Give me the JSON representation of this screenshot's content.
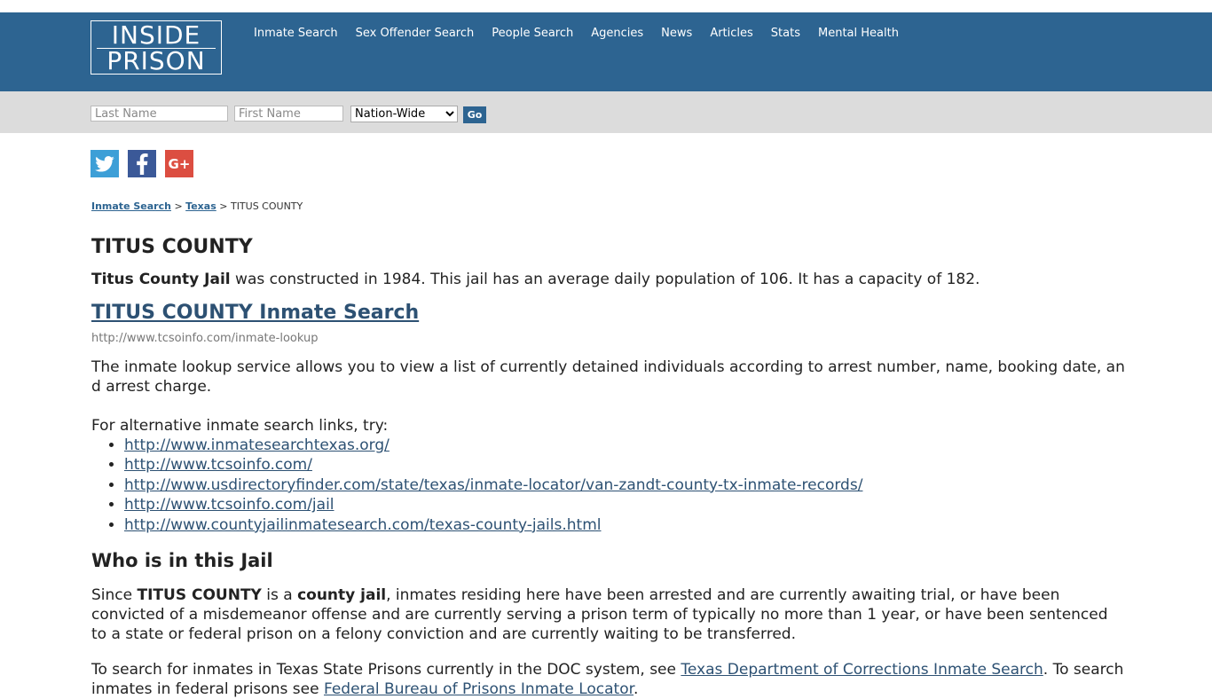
{
  "logo": {
    "line1": "INSIDE",
    "line2": "PRISON"
  },
  "nav": [
    "Inmate Search",
    "Sex Offender Search",
    "People Search",
    "Agencies",
    "News",
    "Articles",
    "Stats",
    "Mental Health"
  ],
  "search": {
    "last_placeholder": "Last Name",
    "first_placeholder": "First Name",
    "scope": "Nation-Wide",
    "go": "Go"
  },
  "social": {
    "twitter": "t",
    "facebook": "f",
    "google": "G+"
  },
  "breadcrumb": {
    "home": "Inmate Search",
    "sep1": " > ",
    "state": "Texas",
    "sep2": " > ",
    "current": "TITUS COUNTY"
  },
  "title": "TITUS COUNTY",
  "intro": {
    "bold": "Titus County Jail",
    "rest": " was constructed in 1984. This jail has an average daily population of 106. It has a capacity of 182."
  },
  "search_link": "TITUS COUNTY Inmate Search",
  "search_url": "http://www.tcsoinfo.com/inmate-lookup",
  "description": "The inmate lookup service allows you to view a list of currently detained individuals according to arrest number, name, booking date, and arrest charge.",
  "alt_intro": "For alternative inmate search links, try:",
  "alt_links": [
    "http://www.inmatesearchtexas.org/",
    "http://www.tcsoinfo.com/",
    "http://www.usdirectoryfinder.com/state/texas/inmate-locator/van-zandt-county-tx-inmate-records/",
    "http://www.tcsoinfo.com/jail",
    "http://www.countyjailinmatesearch.com/texas-county-jails.html"
  ],
  "who_heading": "Who is in this Jail",
  "since": {
    "a": "Since ",
    "b": "TITUS COUNTY",
    "c": " is a ",
    "d": "county jail",
    "e": ", inmates residing here have been arrested and are currently awaiting trial, or have been convicted of a misdemeanor offense and are currently serving a prison term of typically no more than 1 year, or have been sentenced to a state or federal prison on a felony conviction and are currently waiting to be transferred."
  },
  "tosearch": {
    "a": "To search for inmates in Texas State Prisons currently in the DOC system, see ",
    "link1": "Texas Department of Corrections Inmate Search",
    "b": ". To search inmates in federal prisons see ",
    "link2": "Federal Bureau of Prisons Inmate Locator",
    "c": "."
  }
}
